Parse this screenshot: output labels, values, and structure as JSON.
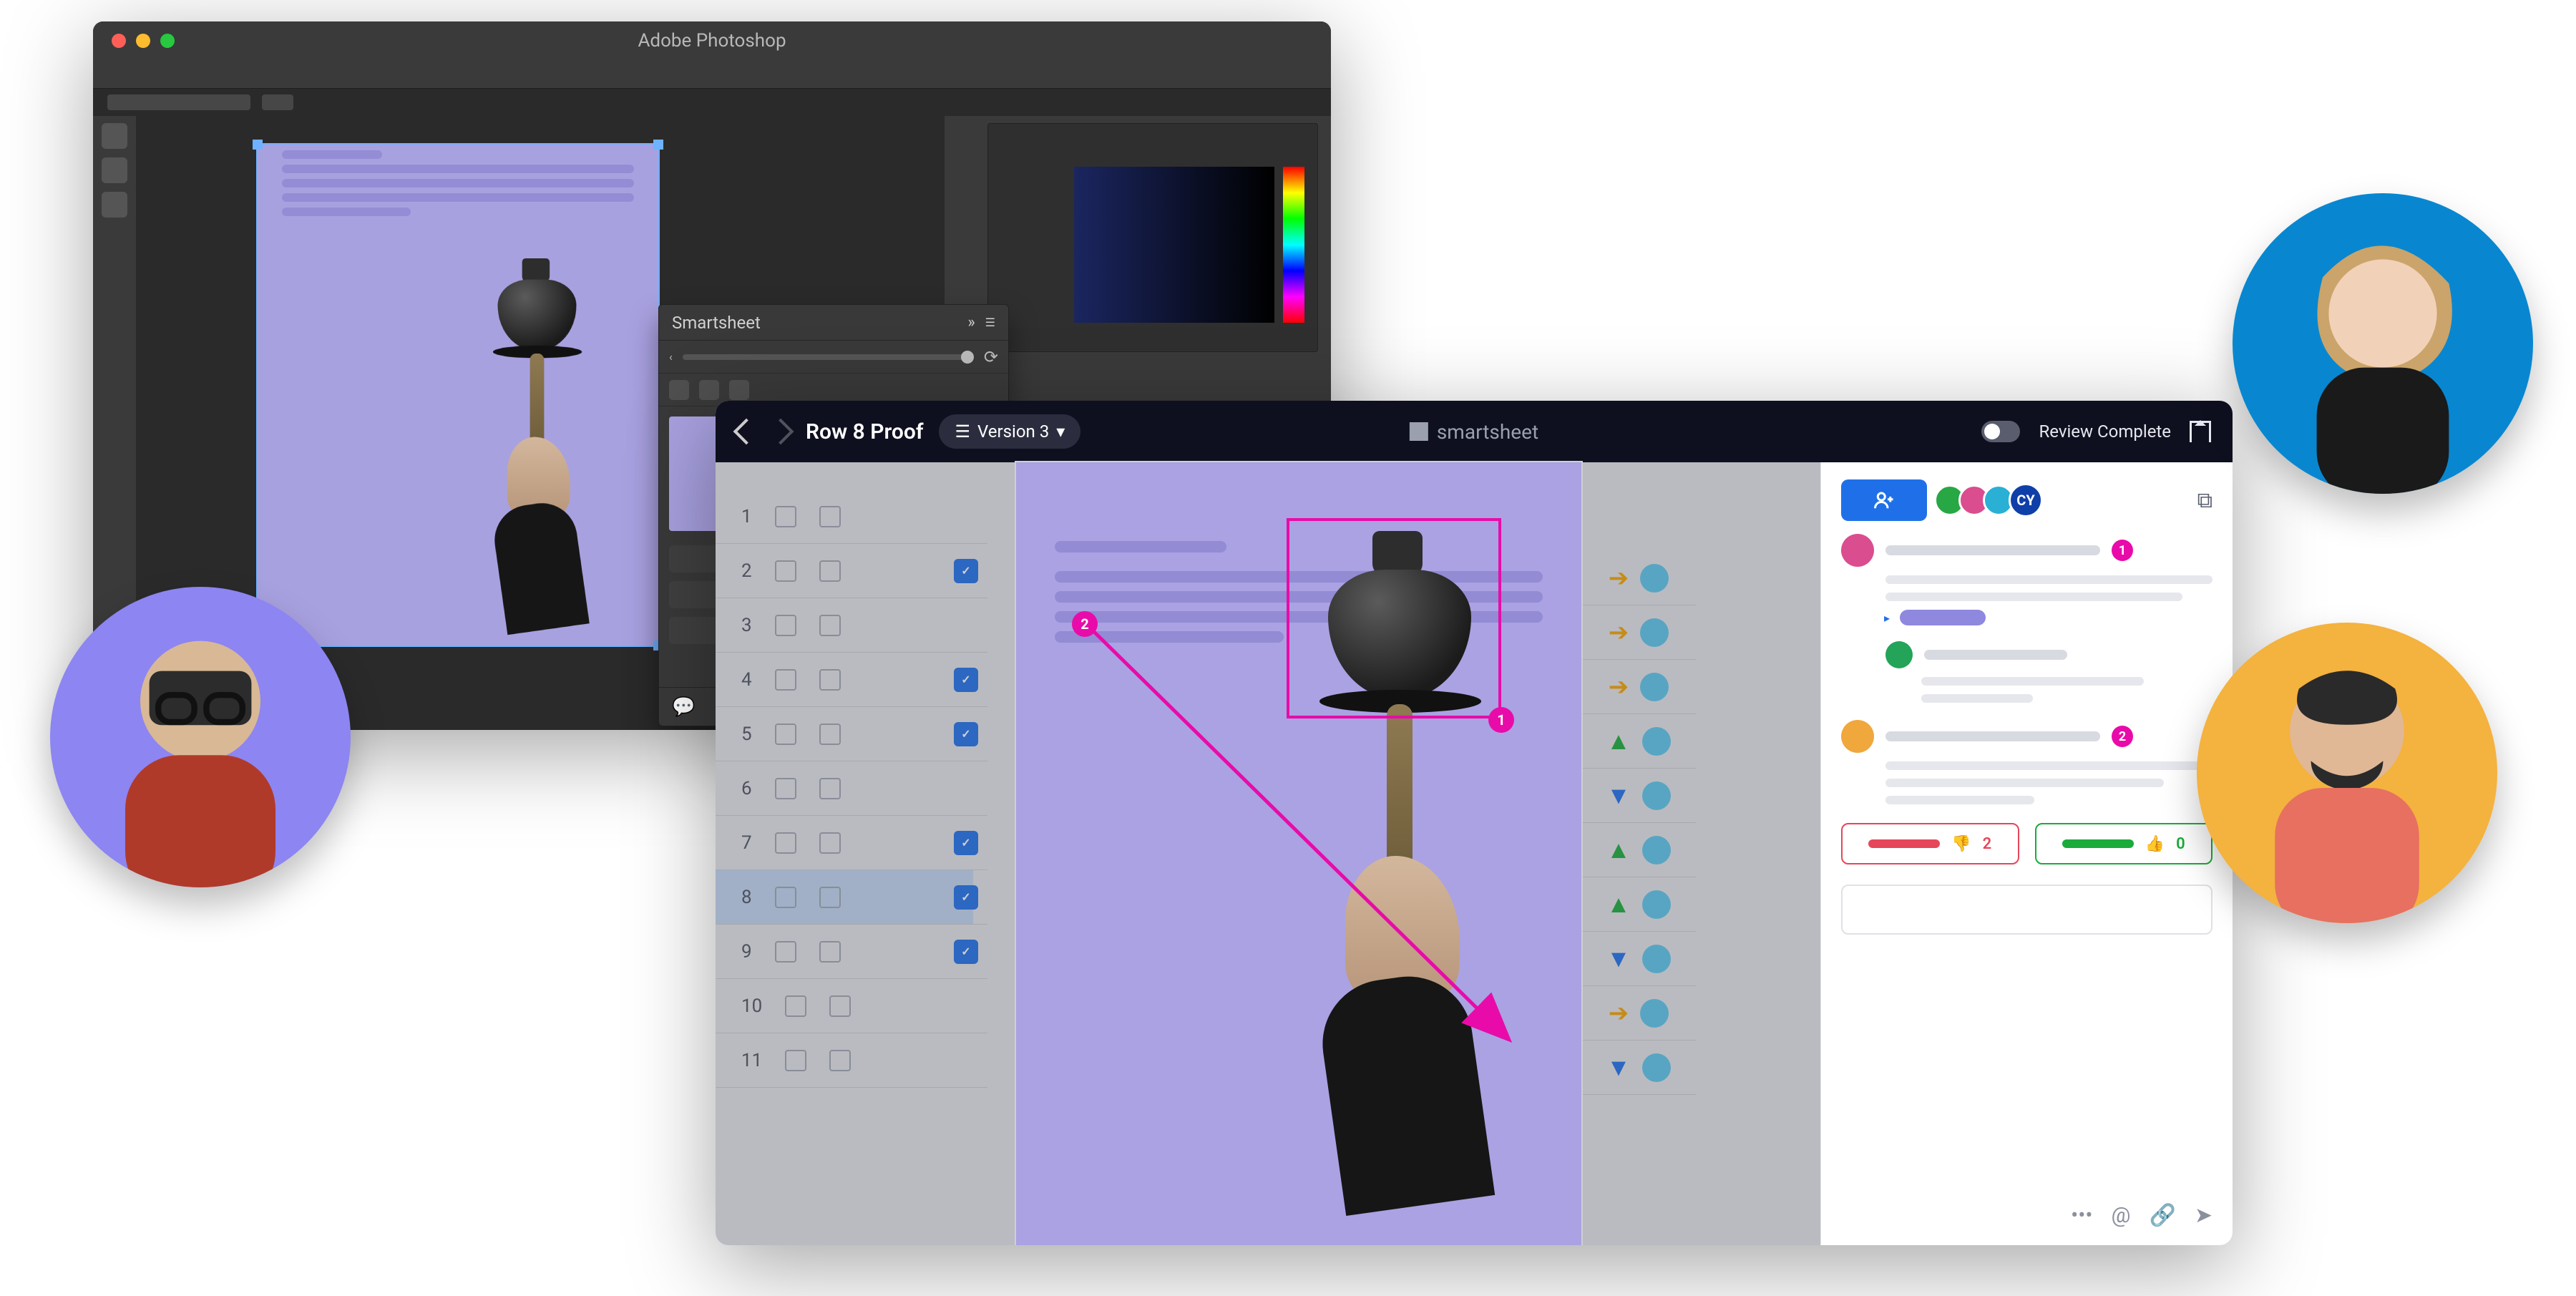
{
  "photoshop": {
    "title": "Adobe Photoshop",
    "panel_title": "Smartsheet"
  },
  "smartsheet": {
    "brand": "smartsheet",
    "back_fwd": {
      "back": "‹",
      "fwd": "›"
    },
    "proof_title": "Row 8 Proof",
    "version_label": "Version 3",
    "review_complete_label": "Review Complete",
    "annotations": {
      "box_num": "1",
      "arrow_num": "2"
    },
    "grid": {
      "rows": [
        1,
        2,
        3,
        4,
        5,
        6,
        7,
        8,
        9,
        10,
        11
      ],
      "selected_row": 8,
      "checked_rows": [
        2,
        4,
        5,
        7,
        8,
        9
      ]
    },
    "comments": {
      "cy_initials": "CY",
      "thread1_badge": "1",
      "thread2_badge": "2",
      "downvote_count": "2",
      "upvote_count": "0"
    }
  },
  "icons": {
    "layers": "☰",
    "refresh": "⟳",
    "more": "•••",
    "mention": "@",
    "link": "🔗",
    "send": "➤",
    "popout": "⧉",
    "thumbs_down": "👎",
    "thumbs_up": "👍",
    "person_add": "＋",
    "checkmark": "✓",
    "chevdown": "▾"
  }
}
